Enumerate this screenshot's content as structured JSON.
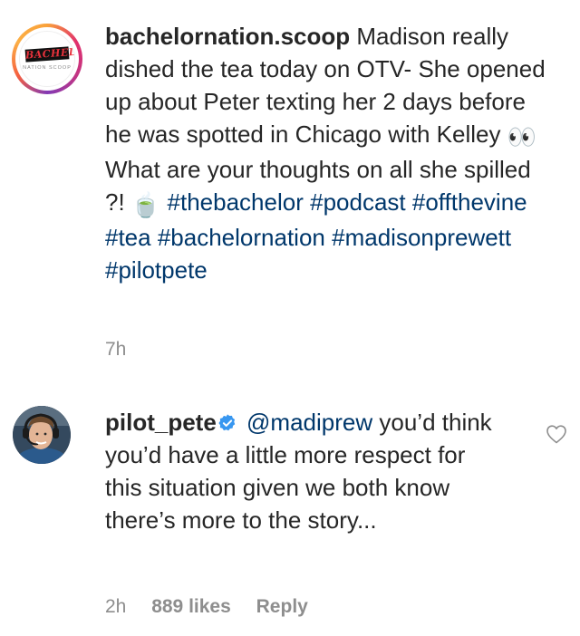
{
  "caption": {
    "username": "bachelornation.scoop",
    "avatar_logo_text": "BACHELOR",
    "avatar_logo_subtext": "NATION SCOOP",
    "text_1": "Madison really dished the tea today on OTV- She opened up about Peter texting her 2 days before he was spotted in Chicago with Kelley",
    "text_2": "What are your thoughts on all she spilled ?!",
    "emoji_eyes": "👀",
    "emoji_tea": "🍵",
    "hashtags": [
      "#thebachelor",
      "#podcast",
      "#offthevine",
      "#tea",
      "#bachelornation",
      "#madisonprewett",
      "#pilotpete"
    ],
    "time": "7h"
  },
  "reply": {
    "username": "pilot_pete",
    "verified_icon": "verified-badge-icon",
    "mention": "@madiprew",
    "text": "you’d think you’d have a little more respect for this situation given we both know there’s more to the story...",
    "time": "2h",
    "likes": "889 likes",
    "reply_label": "Reply",
    "like_icon": "heart-outline-icon"
  },
  "colors": {
    "text": "#262626",
    "hashtag": "#00376b",
    "meta": "#8e8e8e",
    "verified": "#3897f0"
  }
}
